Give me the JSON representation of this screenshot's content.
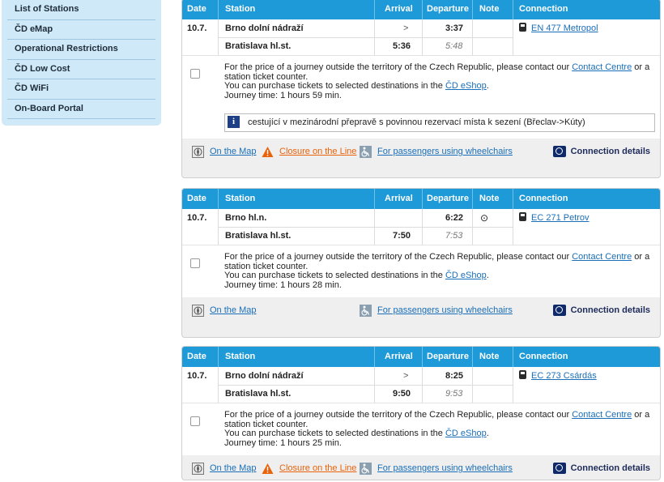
{
  "sidebar": {
    "items": [
      "List of Stations",
      "ČD eMap",
      "Operational Restrictions",
      "ČD Low Cost",
      "ČD WiFi",
      "On-Board Portal"
    ]
  },
  "table_headers": {
    "date": "Date",
    "station": "Station",
    "arrival": "Arrival",
    "departure": "Departure",
    "note": "Note",
    "connection": "Connection"
  },
  "price_text": {
    "line1_before": "For the price of a journey outside the territory of the Czech Republic, please contact our ",
    "contact_link": "Contact Centre",
    "line1_after": " or a station ticket counter.",
    "line2_before": "You can purchase tickets to selected destinations in the ",
    "eshop_link": "ČD eShop",
    "line2_after": "."
  },
  "footer": {
    "map": "On the Map",
    "closure": "Closure on the Line",
    "wheelchair": "For passengers using wheelchairs",
    "details": "Connection details"
  },
  "connections": [
    {
      "date": "10.7.",
      "from_station": "Brno dolní nádraží",
      "from_arrival": ">",
      "from_departure": "3:37",
      "from_note": "",
      "train": "EN 477 Metropol",
      "to_station": "Bratislava hl.st.",
      "to_arrival": "5:36",
      "to_departure": "5:48",
      "journey_time": "Journey time: 1 hours 59 min.",
      "notice": "cestující v mezinárodní přepravě s povinnou rezervací místa k sezení (Břeclav->Kúty)"
    },
    {
      "date": "10.7.",
      "from_station": "Brno hl.n.",
      "from_arrival": "",
      "from_departure": "6:22",
      "from_note": "⊙",
      "train": "EC 271 Petrov",
      "to_station": "Bratislava hl.st.",
      "to_arrival": "7:50",
      "to_departure": "7:53",
      "journey_time": "Journey time: 1 hours 28 min."
    },
    {
      "date": "10.7.",
      "from_station": "Brno dolní nádraží",
      "from_arrival": ">",
      "from_departure": "8:25",
      "from_note": "",
      "train": "EC 273 Csárdás",
      "to_station": "Bratislava hl.st.",
      "to_arrival": "9:50",
      "to_departure": "9:53",
      "journey_time": "Journey time: 1 hours 25 min."
    }
  ],
  "colors": {
    "header_blue": "#1e9ad8",
    "sidebar_bg": "#cfe9f8",
    "link": "#1a6fb8",
    "closure_orange": "#e8630a"
  }
}
